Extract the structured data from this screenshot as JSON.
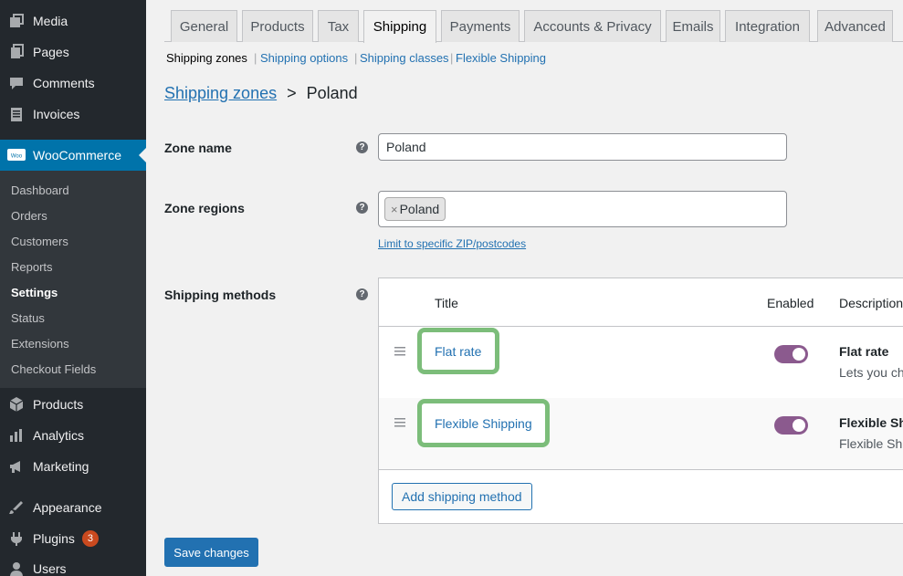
{
  "sidebar": {
    "items": [
      {
        "label": "Media",
        "icon": "media-icon"
      },
      {
        "label": "Pages",
        "icon": "pages-icon"
      },
      {
        "label": "Comments",
        "icon": "comments-icon"
      },
      {
        "label": "Invoices",
        "icon": "invoices-icon"
      },
      {
        "label": "WooCommerce",
        "icon": "woo-icon",
        "active": true
      },
      {
        "label": "Products",
        "icon": "products-icon"
      },
      {
        "label": "Analytics",
        "icon": "analytics-icon"
      },
      {
        "label": "Marketing",
        "icon": "marketing-icon"
      },
      {
        "label": "Appearance",
        "icon": "appearance-icon"
      },
      {
        "label": "Plugins",
        "icon": "plugins-icon",
        "badge": "3"
      },
      {
        "label": "Users",
        "icon": "users-icon"
      }
    ],
    "woo_icon_text": "Woo",
    "submenu": [
      "Dashboard",
      "Orders",
      "Customers",
      "Reports",
      "Settings",
      "Status",
      "Extensions",
      "Checkout Fields"
    ]
  },
  "tabs": [
    "General",
    "Products",
    "Tax",
    "Shipping",
    "Payments",
    "Accounts & Privacy",
    "Emails",
    "Integration",
    "Advanced"
  ],
  "subnav": {
    "current": "Shipping zones",
    "links": [
      "Shipping options",
      "Shipping classes",
      "Flexible Shipping"
    ],
    "separator": "|"
  },
  "breadcrumb": {
    "link": "Shipping zones",
    "separator": ">",
    "current": "Poland"
  },
  "form": {
    "zone_name_label": "Zone name",
    "zone_name_value": "Poland",
    "zone_regions_label": "Zone regions",
    "region_chip_remove": "×",
    "region_chip": "Poland",
    "limit_link": "Limit to specific ZIP/postcodes",
    "shipping_methods_label": "Shipping methods",
    "help_glyph": "?"
  },
  "methods_table": {
    "headers": {
      "title": "Title",
      "enabled": "Enabled",
      "description": "Description"
    },
    "rows": [
      {
        "title": "Flat rate",
        "enabled": true,
        "desc_title": "Flat rate",
        "desc_text": "Lets you ch"
      },
      {
        "title": "Flexible Shipping",
        "enabled": true,
        "desc_title": "Flexible Shi",
        "desc_text": "Flexible Shi"
      }
    ],
    "add_button": "Add shipping method"
  },
  "save_button": "Save changes",
  "colors": {
    "accent": "#2271b1",
    "toggle_on": "#8b5a8e",
    "highlight": "#7cbd7a",
    "sidebar": "#23282d"
  }
}
